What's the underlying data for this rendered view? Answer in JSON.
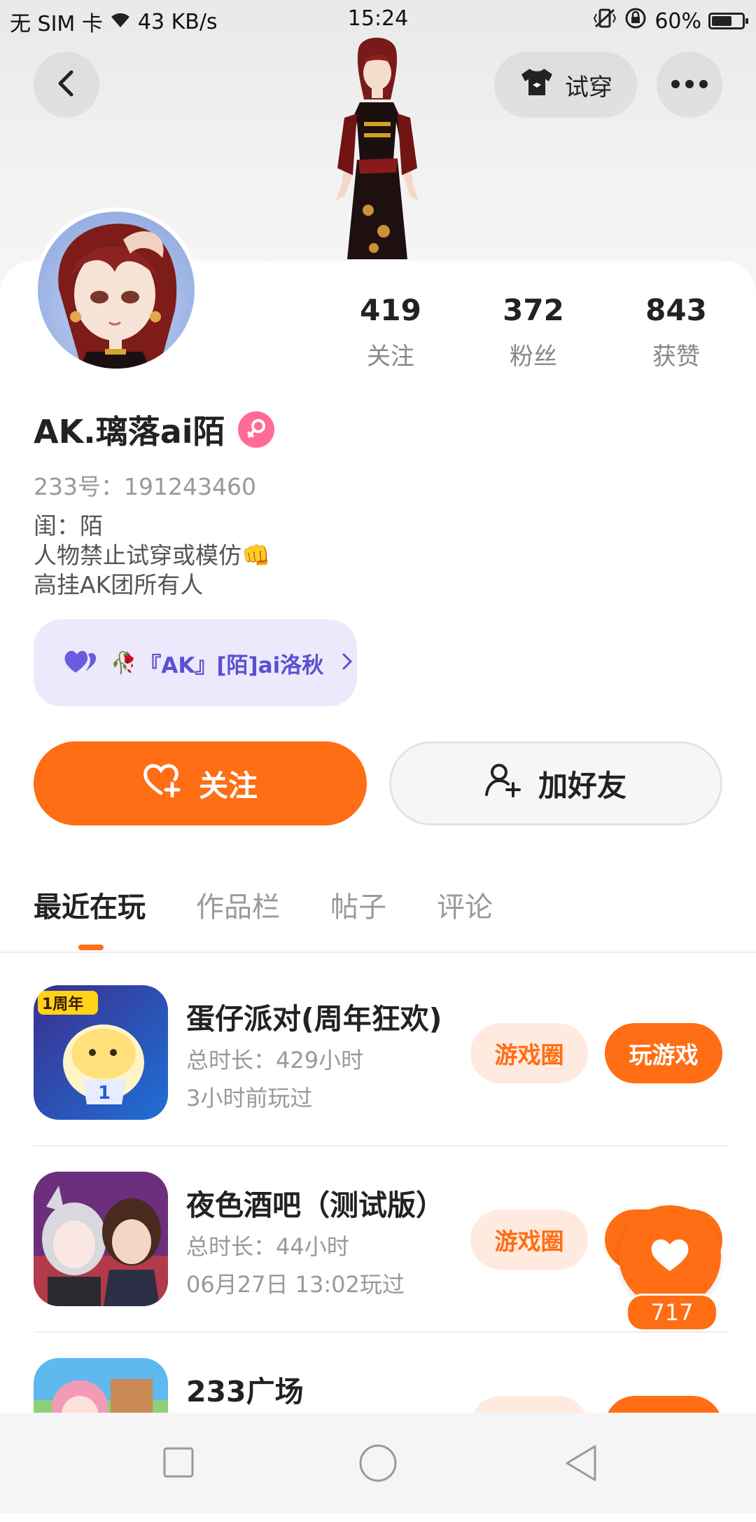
{
  "status_bar": {
    "carrier": "无 SIM 卡",
    "speed": "43 KB/s",
    "time": "15:24",
    "battery": "60%"
  },
  "header": {
    "try_on_label": "试穿"
  },
  "stats": [
    {
      "value": "419",
      "label": "关注"
    },
    {
      "value": "372",
      "label": "粉丝"
    },
    {
      "value": "843",
      "label": "获赞"
    }
  ],
  "profile": {
    "name": "AK.璃落ai陌",
    "uid": "233号：191243460",
    "bio": [
      "闺：陌",
      "人物禁止试穿或模仿",
      "高挂AK团所有人"
    ],
    "bio_emoji": "👊"
  },
  "guild": {
    "label": "『AK』[陌]ai洛秋",
    "rose": "🥀"
  },
  "actions": {
    "follow_label": "关注",
    "add_friend_label": "加好友"
  },
  "tabs": [
    "最近在玩",
    "作品栏",
    "帖子",
    "评论"
  ],
  "games": [
    {
      "title": "蛋仔派对(周年狂欢)",
      "duration": "总时长：429小时",
      "last_played": "3小时前玩过",
      "icon_badge": "1周年"
    },
    {
      "title": "夜色酒吧（测试版）",
      "duration": "总时长：44小时",
      "last_played": "06月27日 13:02玩过"
    },
    {
      "title": "233广场"
    }
  ],
  "game_actions": {
    "circle_label": "游戏圈",
    "play_label": "玩游戏"
  },
  "like": {
    "count": "717"
  },
  "colors": {
    "accent": "#ff6d14",
    "guild_text": "#5b4fd2",
    "gender_badge": "#ff6a97"
  }
}
